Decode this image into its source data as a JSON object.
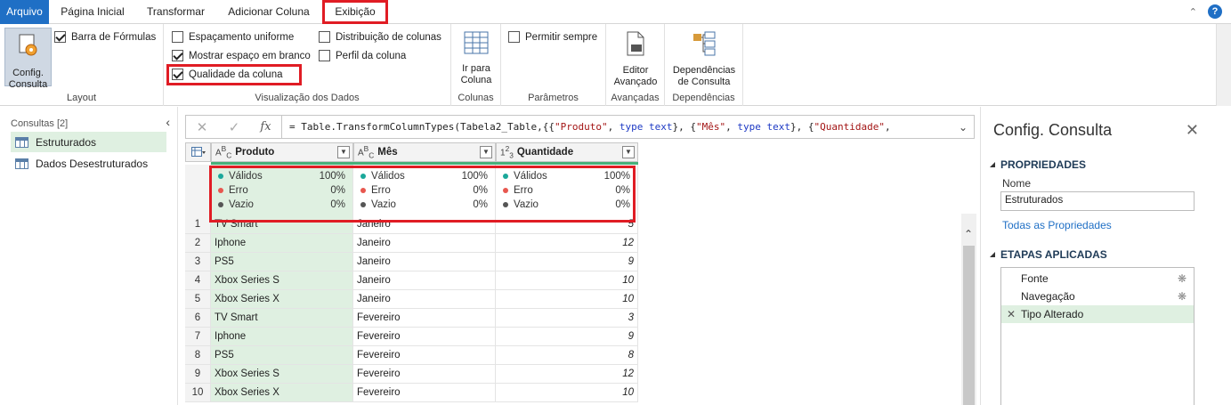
{
  "tabs": {
    "file": "Arquivo",
    "home": "Página Inicial",
    "transform": "Transformar",
    "add_column": "Adicionar Coluna",
    "view": "Exibição"
  },
  "ribbon": {
    "config_btn_line1": "Config.",
    "config_btn_line2": "Consulta",
    "formula_bar": "Barra de Fórmulas",
    "layout_label": "Layout",
    "uniform_spacing": "Espaçamento uniforme",
    "show_whitespace": "Mostrar espaço em branco",
    "column_quality": "Qualidade da coluna",
    "column_distribution": "Distribuição de colunas",
    "column_profile": "Perfil da coluna",
    "data_preview_label": "Visualização dos Dados",
    "goto_column_line1": "Ir para",
    "goto_column_line2": "Coluna",
    "columns_label": "Colunas",
    "allow_always": "Permitir sempre",
    "params_label": "Parâmetros",
    "advanced_editor_line1": "Editor",
    "advanced_editor_line2": "Avançado",
    "advanced_label": "Avançadas",
    "deps_line1": "Dependências",
    "deps_line2": "de Consulta",
    "deps_label": "Dependências"
  },
  "queries": {
    "title": "Consultas [2]",
    "items": [
      "Estruturados",
      "Dados Desestruturados"
    ]
  },
  "formula": {
    "prefix": "= Table.TransformColumnTypes(Tabela2_Table,{{",
    "s1": "\"Produto\"",
    "sep1": ", ",
    "kw1": "type text",
    "mid1": "}, {",
    "s2": "\"Mês\"",
    "sep2": ", ",
    "kw2": "type text",
    "mid2": "}, {",
    "s3": "\"Quantidade\"",
    "tail": ","
  },
  "grid": {
    "columns": [
      {
        "type": "ABC",
        "name": "Produto"
      },
      {
        "type": "123",
        "name": "Mês"
      },
      {
        "type": "123",
        "name": "Quantidade"
      }
    ],
    "col_types_display": [
      "A^B_C",
      "A^B_C",
      "1^2_3"
    ],
    "quality": {
      "valid_label": "Válidos",
      "error_label": "Erro",
      "empty_label": "Vazio",
      "valid_pct": "100%",
      "error_pct": "0%",
      "empty_pct": "0%"
    },
    "rows": [
      {
        "i": "1",
        "produto": "TV Smart",
        "mes": "Janeiro",
        "qtd": "5"
      },
      {
        "i": "2",
        "produto": "Iphone",
        "mes": "Janeiro",
        "qtd": "12"
      },
      {
        "i": "3",
        "produto": "PS5",
        "mes": "Janeiro",
        "qtd": "9"
      },
      {
        "i": "4",
        "produto": "Xbox Series S",
        "mes": "Janeiro",
        "qtd": "10"
      },
      {
        "i": "5",
        "produto": "Xbox Series X",
        "mes": "Janeiro",
        "qtd": "10"
      },
      {
        "i": "6",
        "produto": "TV Smart",
        "mes": "Fevereiro",
        "qtd": "3"
      },
      {
        "i": "7",
        "produto": "Iphone",
        "mes": "Fevereiro",
        "qtd": "9"
      },
      {
        "i": "8",
        "produto": "PS5",
        "mes": "Fevereiro",
        "qtd": "8"
      },
      {
        "i": "9",
        "produto": "Xbox Series S",
        "mes": "Fevereiro",
        "qtd": "12"
      },
      {
        "i": "10",
        "produto": "Xbox Series X",
        "mes": "Fevereiro",
        "qtd": "10"
      }
    ]
  },
  "settings": {
    "title": "Config. Consulta",
    "properties": "PROPRIEDADES",
    "name_label": "Nome",
    "name_value": "Estruturados",
    "all_props": "Todas as Propriedades",
    "applied_steps": "ETAPAS APLICADAS",
    "steps": [
      "Fonte",
      "Navegação",
      "Tipo Alterado"
    ]
  },
  "colors": {
    "accent": "#1f6fc5",
    "highlight_red": "#e01c24",
    "quality_green": "#46b07a",
    "selected_bg": "#dff0e1"
  }
}
